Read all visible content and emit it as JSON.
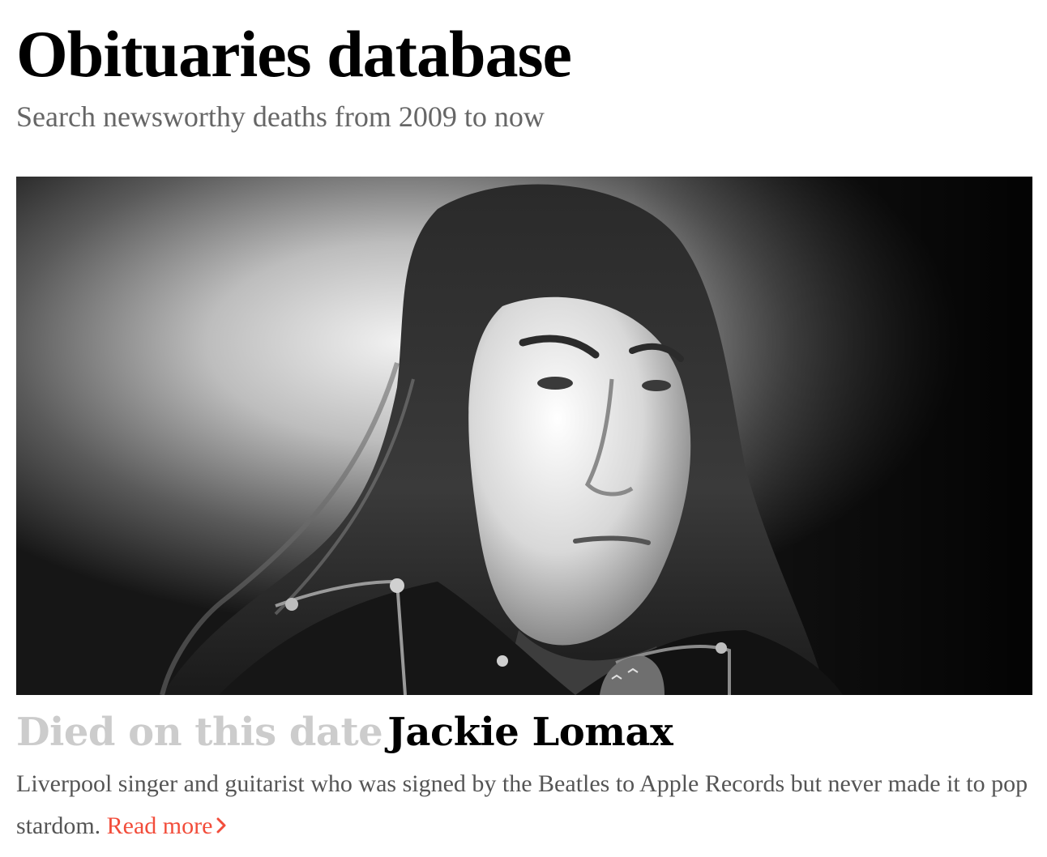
{
  "page": {
    "title": "Obituaries database",
    "subtitle": "Search newsworthy deaths from 2009 to now"
  },
  "featured": {
    "kicker": "Died on this date",
    "name": "Jackie Lomax",
    "summary": "Liverpool singer and guitarist who was signed by the Beatles to Apple Records but never made it to pop stardom.",
    "read_more_label": "Read more",
    "read_more_icon": "chevron-right-icon",
    "photo_description_icon": "portrait-photo"
  },
  "colors": {
    "accent": "#f24d3b",
    "kicker": "#cccccc",
    "subtitle": "#666666",
    "body_text": "#555555"
  }
}
